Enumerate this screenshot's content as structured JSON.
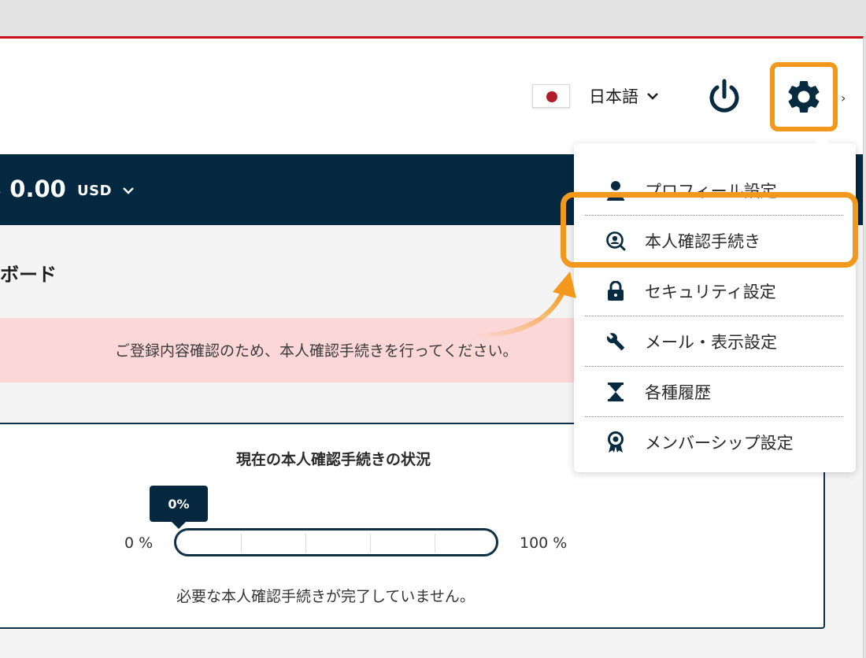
{
  "header": {
    "language": {
      "label": "日本語"
    }
  },
  "balance": {
    "amount": "$ 0.00",
    "currency": "USD"
  },
  "dashboard": {
    "title": "ボード"
  },
  "notice": {
    "text": "ご登録内容確認のため、本人確認手続きを行ってください。"
  },
  "verification_status": {
    "title": "現在の本人確認手続きの状況",
    "progress_label": "0%",
    "progress_value": 0,
    "min_label": "0 %",
    "max_label": "100 %",
    "message": "必要な本人確認手続きが完了していません。"
  },
  "settings_menu": {
    "items": [
      {
        "label": "プロフィール設定",
        "icon": "user-icon"
      },
      {
        "label": "本人確認手続き",
        "icon": "identity-icon"
      },
      {
        "label": "セキュリティ設定",
        "icon": "lock-icon"
      },
      {
        "label": "メール・表示設定",
        "icon": "wrench-icon"
      },
      {
        "label": "各種履歴",
        "icon": "hourglass-icon"
      },
      {
        "label": "メンバーシップ設定",
        "icon": "award-icon"
      }
    ]
  },
  "colors": {
    "navy": "#032840",
    "accent_orange": "#f2991d",
    "brand_red": "#c8101e",
    "notice_pink": "#fcd7d7"
  }
}
